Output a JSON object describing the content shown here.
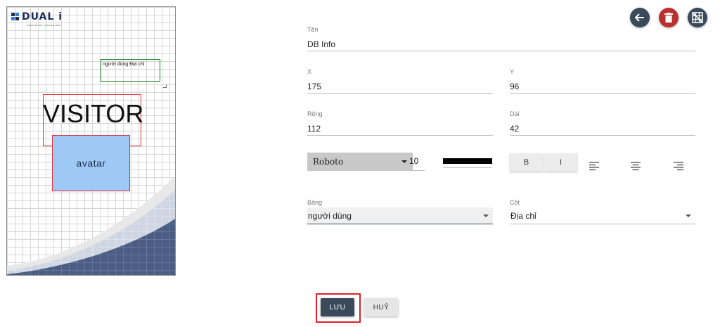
{
  "preview": {
    "logo_text": "DUAL i",
    "logo_tagline": "INNOVATIVE TECHNOLOGY",
    "field_text": "người dùng Địa chỉ",
    "visitor_text": "VISITOR",
    "avatar_label": "avatar"
  },
  "toolbar": {
    "back_icon": "arrow-left-icon",
    "delete_icon": "trash-icon",
    "grid_icon": "grid-off-icon",
    "back_color": "#3a4a5a",
    "delete_color": "#b8312f",
    "grid_color": "#3a4a5a"
  },
  "form": {
    "name": {
      "label": "Tên",
      "value": "DB Info"
    },
    "x": {
      "label": "X",
      "value": "175"
    },
    "y": {
      "label": "Y",
      "value": "96"
    },
    "width": {
      "label": "Rộng",
      "value": "112"
    },
    "height": {
      "label": "Dài",
      "value": "42"
    },
    "font": {
      "value": "Roboto"
    },
    "font_size": {
      "value": "10"
    },
    "text_color": "#000000",
    "bold_label": "B",
    "italic_label": "I",
    "align_icons": [
      "align-left-icon",
      "align-center-icon",
      "align-right-icon"
    ],
    "table": {
      "label": "Bảng",
      "value": "người dùng"
    },
    "column": {
      "label": "Cột",
      "value": "Địa chỉ"
    }
  },
  "actions": {
    "save_label": "LƯU",
    "cancel_label": "HUỶ"
  },
  "colors": {
    "accent_dark": "#3a4a5a",
    "danger": "#b8312f",
    "highlight": "#e0202a"
  }
}
